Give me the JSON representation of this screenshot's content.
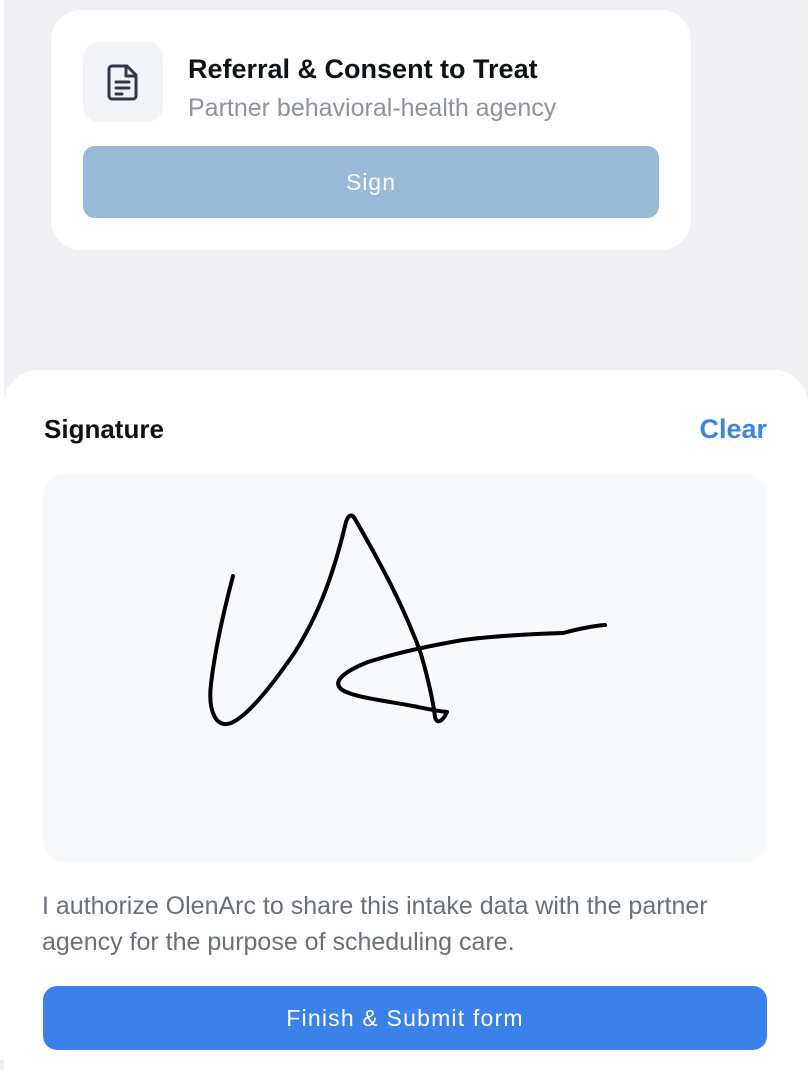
{
  "document": {
    "title": "Referral & Consent to Treat",
    "subtitle": "Partner behavioral-health agency",
    "icon": "document-icon",
    "sign_label": "Sign"
  },
  "signature_sheet": {
    "title": "Signature",
    "clear_label": "Clear",
    "consent_text": "I authorize OlenArc to share this intake data with the partner agency for the purpose of scheduling care.",
    "submit_label": "Finish & Submit form"
  },
  "colors": {
    "page_background": "#f0f0f4",
    "sign_button_disabled": "#9ab9d6",
    "accent": "#3a82ea",
    "link": "#3d86e0"
  }
}
